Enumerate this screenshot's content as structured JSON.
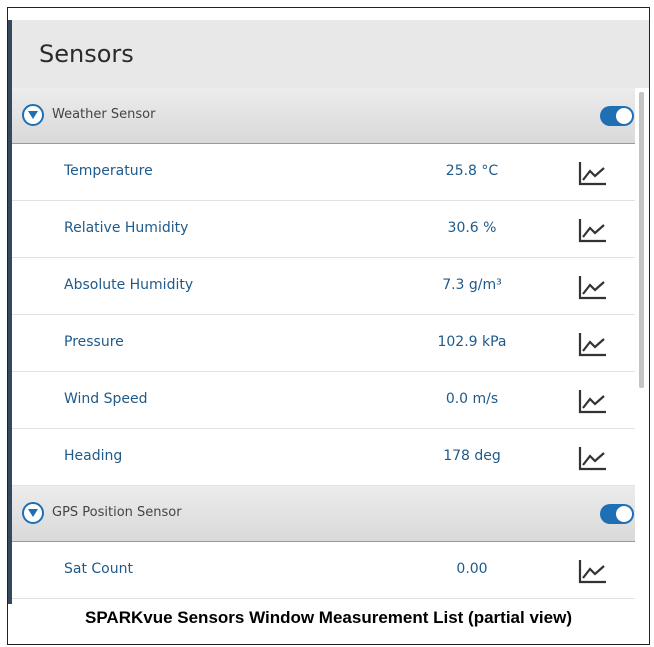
{
  "header": {
    "title": "Sensors"
  },
  "groups": [
    {
      "name": "Weather Sensor",
      "enabled": true,
      "rows": [
        {
          "name": "Temperature",
          "value": "25.8 °C"
        },
        {
          "name": "Relative Humidity",
          "value": "30.6 %"
        },
        {
          "name": "Absolute Humidity",
          "value": "7.3 g/m³"
        },
        {
          "name": "Pressure",
          "value": "102.9 kPa"
        },
        {
          "name": "Wind Speed",
          "value": "0.0 m/s"
        },
        {
          "name": "Heading",
          "value": "178 deg"
        }
      ]
    },
    {
      "name": "GPS Position Sensor",
      "enabled": true,
      "rows": [
        {
          "name": "Sat Count",
          "value": "0.00"
        }
      ]
    }
  ],
  "caption": "SPARKvue Sensors Window Measurement List (partial view)",
  "icons": {
    "expand": "chevron-down-icon",
    "graph": "line-graph-icon"
  },
  "colors": {
    "accent": "#1f6fb5",
    "text": "#1f5a8a",
    "sidebar": "#34495e"
  }
}
